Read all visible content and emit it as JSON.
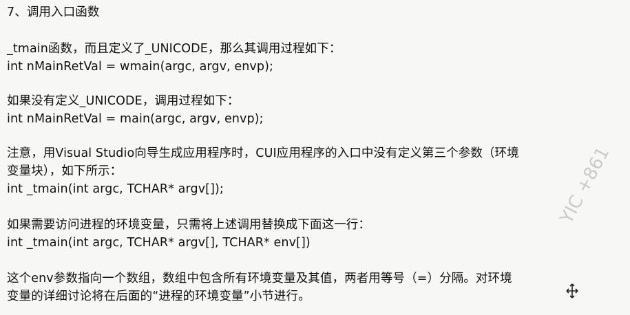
{
  "doc": {
    "title": "7、调用入口函数",
    "p1": "_tmain函数，而且定义了_UNICODE，那么其调用过程如下：",
    "code1": "int nMainRetVal = wmain(argc, argv, envp);",
    "p2": "如果没有定义_UNICODE，调用过程如下：",
    "code2": "int nMainRetVal = main(argc, argv, envp);",
    "p3a": "注意，用Visual Studio向导生成应用程序时，CUI应用程序的入口中没有定义第三个参数（环境",
    "p3b": "变量块），如下所示：",
    "code3": "int _tmain(int argc, TCHAR* argv[]);",
    "p4": "如果需要访问进程的环境变量，只需将上述调用替换成下面这一行：",
    "code4": "int _tmain(int argc, TCHAR* argv[], TCHAR* env[])",
    "p5a": "这个env参数指向一个数组，数组中包含所有环境变量及其值，两者用等号（=）分隔。对环境",
    "p5b": "变量的详细讨论将在后面的“进程的环境变量”小节进行。"
  },
  "watermark": "YIC +861",
  "colors": {
    "background": "#f7f7f5",
    "text": "#111111"
  }
}
